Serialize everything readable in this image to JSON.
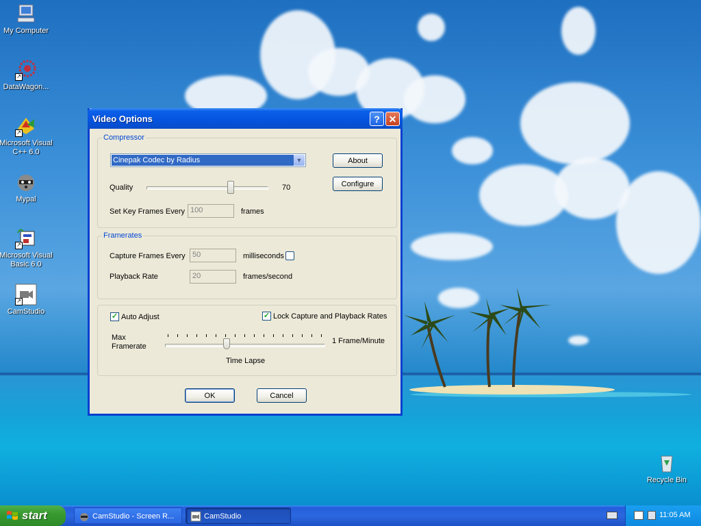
{
  "desktop": {
    "icons": [
      {
        "label": "My Computer"
      },
      {
        "label": "DataWagon..."
      },
      {
        "label": "Microsoft Visual C++ 6.0"
      },
      {
        "label": "Mypal"
      },
      {
        "label": "Microsoft Visual Basic 6.0"
      },
      {
        "label": "CamStudio"
      },
      {
        "label": "Recycle Bin"
      }
    ]
  },
  "dialog": {
    "title": "Video Options",
    "help_glyph": "?",
    "close_glyph": "✕",
    "compressor": {
      "group_label": "Compressor",
      "codec_value": "Cinepak Codec by Radius",
      "about_label": "About",
      "configure_label": "Configure",
      "quality_label": "Quality",
      "quality_value": "70",
      "keyframes_label": "Set Key Frames Every",
      "keyframes_value": "100",
      "keyframes_unit": "frames"
    },
    "framerates": {
      "group_label": "Framerates",
      "capture_label": "Capture Frames Every",
      "capture_value": "50",
      "capture_unit": "milliseconds",
      "playback_label": "Playback Rate",
      "playback_value": "20",
      "playback_unit": "frames/second"
    },
    "adjust": {
      "auto_adjust_label": "Auto Adjust",
      "auto_adjust_checked": true,
      "lock_label": "Lock Capture and Playback Rates",
      "lock_checked": true,
      "max_framerate_label_1": "Max",
      "max_framerate_label_2": "Framerate",
      "rate_value": "1 Frame/Minute",
      "time_lapse_label": "Time Lapse"
    },
    "ok_label": "OK",
    "cancel_label": "Cancel"
  },
  "taskbar": {
    "start_label": "start",
    "tasks": [
      {
        "label": "CamStudio - Screen R..."
      },
      {
        "label": "CamStudio"
      }
    ],
    "clock": "11:05 AM"
  },
  "colors": {
    "accent": "#0a5fe8",
    "group_label": "#0046d5",
    "start_green": "#389a30"
  }
}
